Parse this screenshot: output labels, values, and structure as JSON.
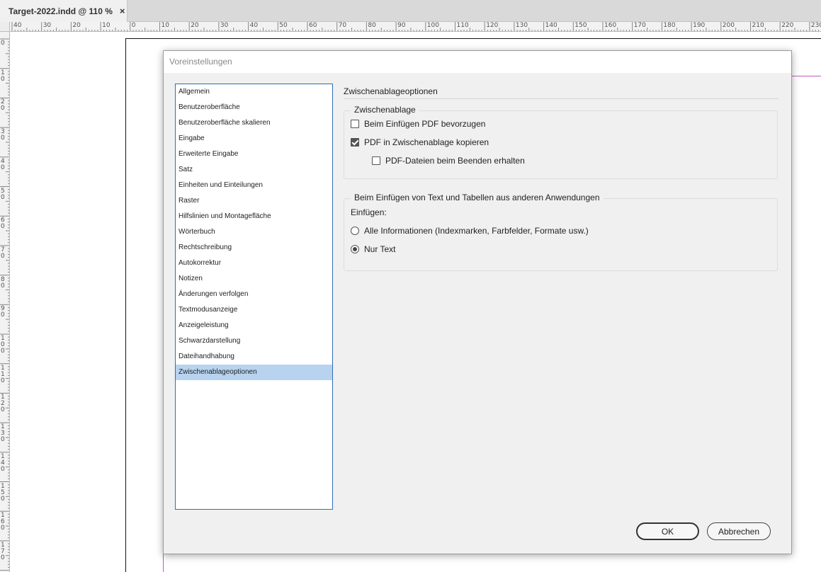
{
  "tab": {
    "title": "Target-2022.indd @ 110 %",
    "close_glyph": "×"
  },
  "ruler": {
    "horizontal_labels": [
      "40",
      "30",
      "20",
      "10",
      "0",
      "10",
      "20",
      "30",
      "40",
      "50",
      "60",
      "70",
      "80",
      "90",
      "100",
      "110",
      "120",
      "130",
      "140",
      "150",
      "160",
      "170",
      "180",
      "190",
      "200",
      "210",
      "220",
      "230"
    ],
    "vertical_labels": [
      "0",
      "1 0",
      "2 0",
      "3 0",
      "4 0",
      "5 0",
      "6 0",
      "7 0",
      "8 0",
      "9 0",
      "1 0 0",
      "1 1 0",
      "1 2 0",
      "1 3 0",
      "1 4 0",
      "1 5 0",
      "1 6 0",
      "1 7 0"
    ]
  },
  "dialog": {
    "title": "Voreinstellungen",
    "categories": [
      "Allgemein",
      "Benutzeroberfläche",
      "Benutzeroberfläche skalieren",
      "Eingabe",
      "Erweiterte Eingabe",
      "Satz",
      "Einheiten und Einteilungen",
      "Raster",
      "Hilfslinien und Montagefläche",
      "Wörterbuch",
      "Rechtschreibung",
      "Autokorrektur",
      "Notizen",
      "Änderungen verfolgen",
      "Textmodusanzeige",
      "Anzeigeleistung",
      "Schwarzdarstellung",
      "Dateihandhabung",
      "Zwischenablageoptionen"
    ],
    "selected_category": "Zwischenablageoptionen",
    "section_title": "Zwischenablageoptionen",
    "clipboard_group": {
      "legend": "Zwischenablage",
      "prefer_pdf": {
        "label": "Beim Einfügen PDF bevorzugen",
        "checked": false
      },
      "copy_pdf": {
        "label": "PDF in Zwischenablage kopieren",
        "checked": true
      },
      "keep_pdf": {
        "label": "PDF-Dateien beim Beenden erhalten",
        "checked": false
      }
    },
    "paste_group": {
      "legend": "Beim Einfügen von Text und Tabellen aus anderen Anwendungen",
      "paste_label": "Einfügen:",
      "all_info": {
        "label": "Alle Informationen (Indexmarken, Farbfelder, Formate usw.)",
        "selected": false
      },
      "text_only": {
        "label": "Nur Text",
        "selected": true
      }
    },
    "buttons": {
      "ok": "OK",
      "cancel": "Abbrechen"
    }
  },
  "colors": {
    "selection": "#b7d3f0",
    "list_border": "#2f6fb3",
    "margin_guide": "#c25ac2"
  }
}
